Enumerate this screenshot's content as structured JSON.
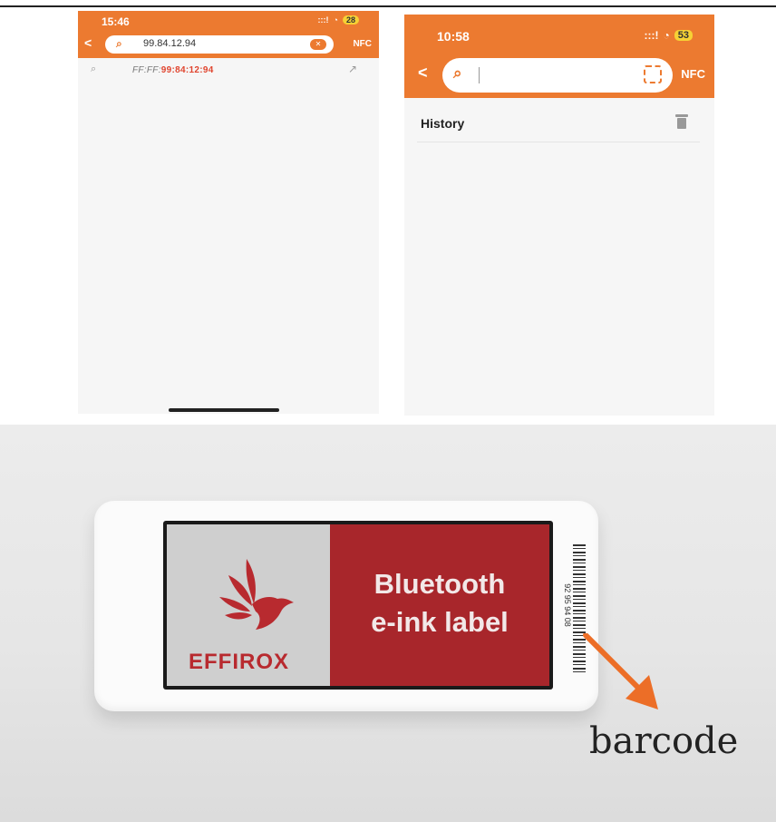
{
  "phone_left": {
    "time": "15:46",
    "signal": ":::!",
    "wifi_icon": "wifi-icon",
    "battery": "28",
    "back": "<",
    "search_value": "99.84.12.94",
    "clear_icon": "clear-icon",
    "nfc": "NFC",
    "result_prefix": "FF:FF:",
    "result_highlight": "99:84:12:94",
    "arrow_icon": "arrow-up-right-icon"
  },
  "phone_right": {
    "time": "10:58",
    "signal": ":::!",
    "battery": "53",
    "back": "<",
    "scan_icon": "scan-icon",
    "nfc": "NFC",
    "history_label": "History",
    "trash_icon": "trash-icon"
  },
  "photo": {
    "brand": "EFFIROX",
    "label_line1": "Bluetooth",
    "label_line2": "e-ink label",
    "barcode_number": "92 95 94 08",
    "caption": "barcode",
    "colors": {
      "panel_red": "#a8262b",
      "arrow_orange": "#ec6e27"
    }
  },
  "theme": {
    "accent": "#ec7a30",
    "highlight": "#e0452f"
  }
}
